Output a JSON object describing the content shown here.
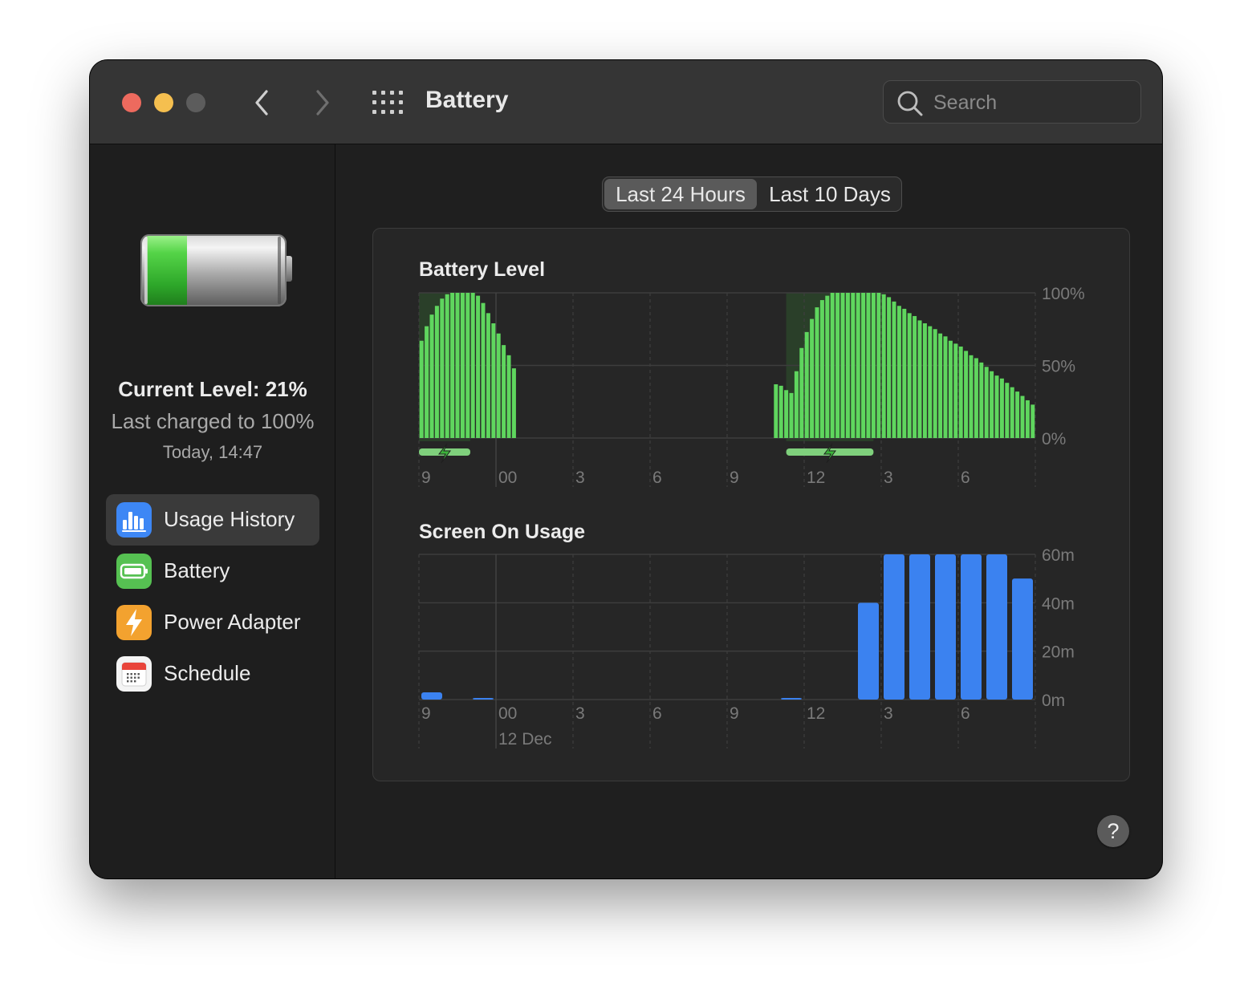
{
  "window": {
    "title": "Battery"
  },
  "search": {
    "placeholder": "Search"
  },
  "sidebar": {
    "current_level": "Current Level: 21%",
    "last_charged": "Last charged to 100%",
    "charge_time": "Today, 14:47",
    "battery_fill_fraction": 0.21,
    "items": [
      {
        "label": "Usage History",
        "icon": "bar-chart-icon",
        "selected": true
      },
      {
        "label": "Battery",
        "icon": "battery-icon",
        "selected": false
      },
      {
        "label": "Power Adapter",
        "icon": "lightning-icon",
        "selected": false
      },
      {
        "label": "Schedule",
        "icon": "calendar-icon",
        "selected": false
      }
    ]
  },
  "segmented": {
    "options": [
      "Last 24 Hours",
      "Last 10 Days"
    ],
    "selected": "Last 24 Hours"
  },
  "help": {
    "label": "?"
  },
  "colors": {
    "battery_green": "#5fd65e",
    "charging_green": "#7fd07c",
    "usage_blue": "#3b82f0"
  },
  "chart_data": [
    {
      "type": "bar",
      "title": "Battery Level",
      "y_tick_labels": [
        "100%",
        "50%",
        "0%"
      ],
      "ylim": [
        0,
        100
      ],
      "x_tick_labels": [
        "9",
        "00",
        "3",
        "6",
        "9",
        "12",
        "3",
        "6"
      ],
      "x_range_hours": [
        21,
        45
      ],
      "grid": true,
      "charging_periods": [
        [
          21.0,
          23.0
        ],
        [
          35.3,
          38.7
        ]
      ],
      "points": [
        [
          21.1,
          67
        ],
        [
          21.3,
          77
        ],
        [
          21.5,
          85
        ],
        [
          21.7,
          91
        ],
        [
          21.9,
          96
        ],
        [
          22.1,
          99
        ],
        [
          22.3,
          100
        ],
        [
          22.5,
          100
        ],
        [
          22.7,
          100
        ],
        [
          22.9,
          100
        ],
        [
          23.1,
          100
        ],
        [
          23.3,
          98
        ],
        [
          23.5,
          93
        ],
        [
          23.7,
          86
        ],
        [
          23.9,
          79
        ],
        [
          24.1,
          72
        ],
        [
          24.3,
          64
        ],
        [
          24.5,
          57
        ],
        [
          24.7,
          48
        ],
        [
          34.9,
          37
        ],
        [
          35.1,
          36
        ],
        [
          35.3,
          33
        ],
        [
          35.5,
          31
        ],
        [
          35.7,
          46
        ],
        [
          35.9,
          62
        ],
        [
          36.1,
          73
        ],
        [
          36.3,
          82
        ],
        [
          36.5,
          90
        ],
        [
          36.7,
          95
        ],
        [
          36.9,
          98
        ],
        [
          37.1,
          100
        ],
        [
          37.3,
          100
        ],
        [
          37.5,
          100
        ],
        [
          37.7,
          100
        ],
        [
          37.9,
          100
        ],
        [
          38.1,
          100
        ],
        [
          38.3,
          100
        ],
        [
          38.5,
          100
        ],
        [
          38.7,
          100
        ],
        [
          38.9,
          100
        ],
        [
          39.1,
          99
        ],
        [
          39.3,
          97
        ],
        [
          39.5,
          94
        ],
        [
          39.7,
          91
        ],
        [
          39.9,
          89
        ],
        [
          40.1,
          86
        ],
        [
          40.3,
          84
        ],
        [
          40.5,
          81
        ],
        [
          40.7,
          79
        ],
        [
          40.9,
          77
        ],
        [
          41.1,
          75
        ],
        [
          41.3,
          72
        ],
        [
          41.5,
          70
        ],
        [
          41.7,
          67
        ],
        [
          41.9,
          65
        ],
        [
          42.1,
          63
        ],
        [
          42.3,
          60
        ],
        [
          42.5,
          57
        ],
        [
          42.7,
          55
        ],
        [
          42.9,
          52
        ],
        [
          43.1,
          49
        ],
        [
          43.3,
          46
        ],
        [
          43.5,
          43
        ],
        [
          43.7,
          41
        ],
        [
          43.9,
          38
        ],
        [
          44.1,
          35
        ],
        [
          44.3,
          32
        ],
        [
          44.5,
          29
        ],
        [
          44.7,
          26
        ],
        [
          44.9,
          23
        ]
      ]
    },
    {
      "type": "bar",
      "title": "Screen On Usage",
      "y_tick_labels": [
        "60m",
        "40m",
        "20m",
        "0m"
      ],
      "ylim": [
        0,
        60
      ],
      "x_tick_labels": [
        "9",
        "00",
        "3",
        "6",
        "9",
        "12",
        "3",
        "6"
      ],
      "date_label": "12 Dec",
      "x_range_hours": [
        21,
        45
      ],
      "grid": true,
      "points": [
        [
          21.5,
          3
        ],
        [
          23.5,
          0.5
        ],
        [
          35.5,
          0.3
        ],
        [
          38.5,
          40
        ],
        [
          39.5,
          60
        ],
        [
          40.5,
          60
        ],
        [
          41.5,
          60
        ],
        [
          42.5,
          60
        ],
        [
          43.5,
          60
        ],
        [
          44.5,
          50
        ]
      ]
    }
  ]
}
